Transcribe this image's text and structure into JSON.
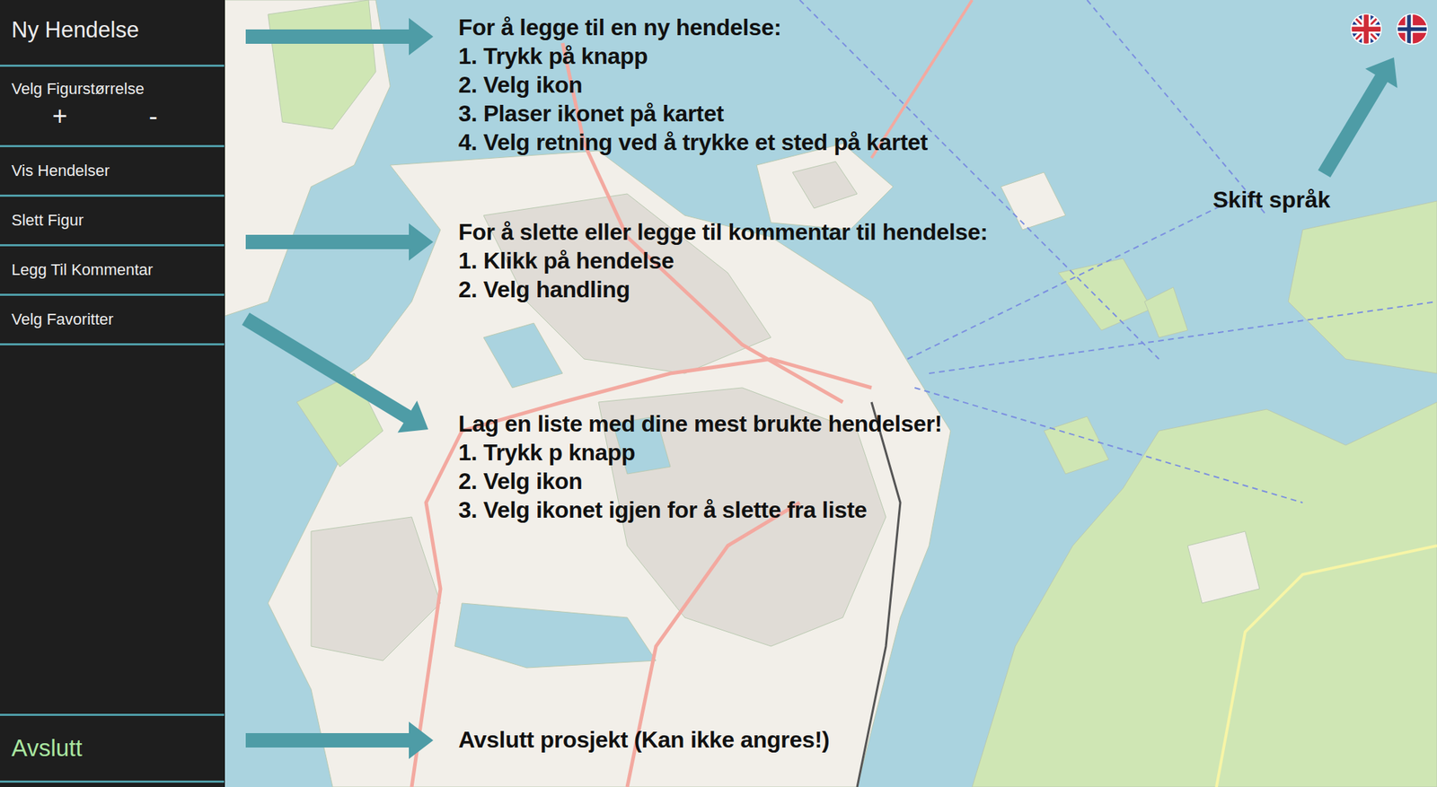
{
  "sidebar": {
    "title": "Ny Hendelse",
    "size": {
      "label": "Velg Figurstørrelse",
      "plus": "+",
      "minus": "-"
    },
    "items": [
      "Vis Hendelser",
      "Slett Figur",
      "Legg Til Kommentar",
      "Velg Favoritter"
    ],
    "exit": "Avslutt"
  },
  "help": [
    {
      "lines": [
        "For å legge til en ny hendelse:",
        "1. Trykk på knapp",
        "2. Velg ikon",
        "3. Plaser ikonet på kartet",
        "4. Velg retning ved å trykke et sted på kartet"
      ]
    },
    {
      "lines": [
        "For å slette eller legge til kommentar til hendelse:",
        "1. Klikk på hendelse",
        "2. Velg handling"
      ]
    },
    {
      "lines": [
        "Lag en liste med dine mest brukte hendelser!",
        "1. Trykk p knapp",
        "2. Velg ikon",
        "3. Velg ikonet igjen for å slette fra liste"
      ]
    }
  ],
  "exit_note": "Avslutt prosjekt (Kan ikke angres!)",
  "language": {
    "label": "Skift språk"
  }
}
